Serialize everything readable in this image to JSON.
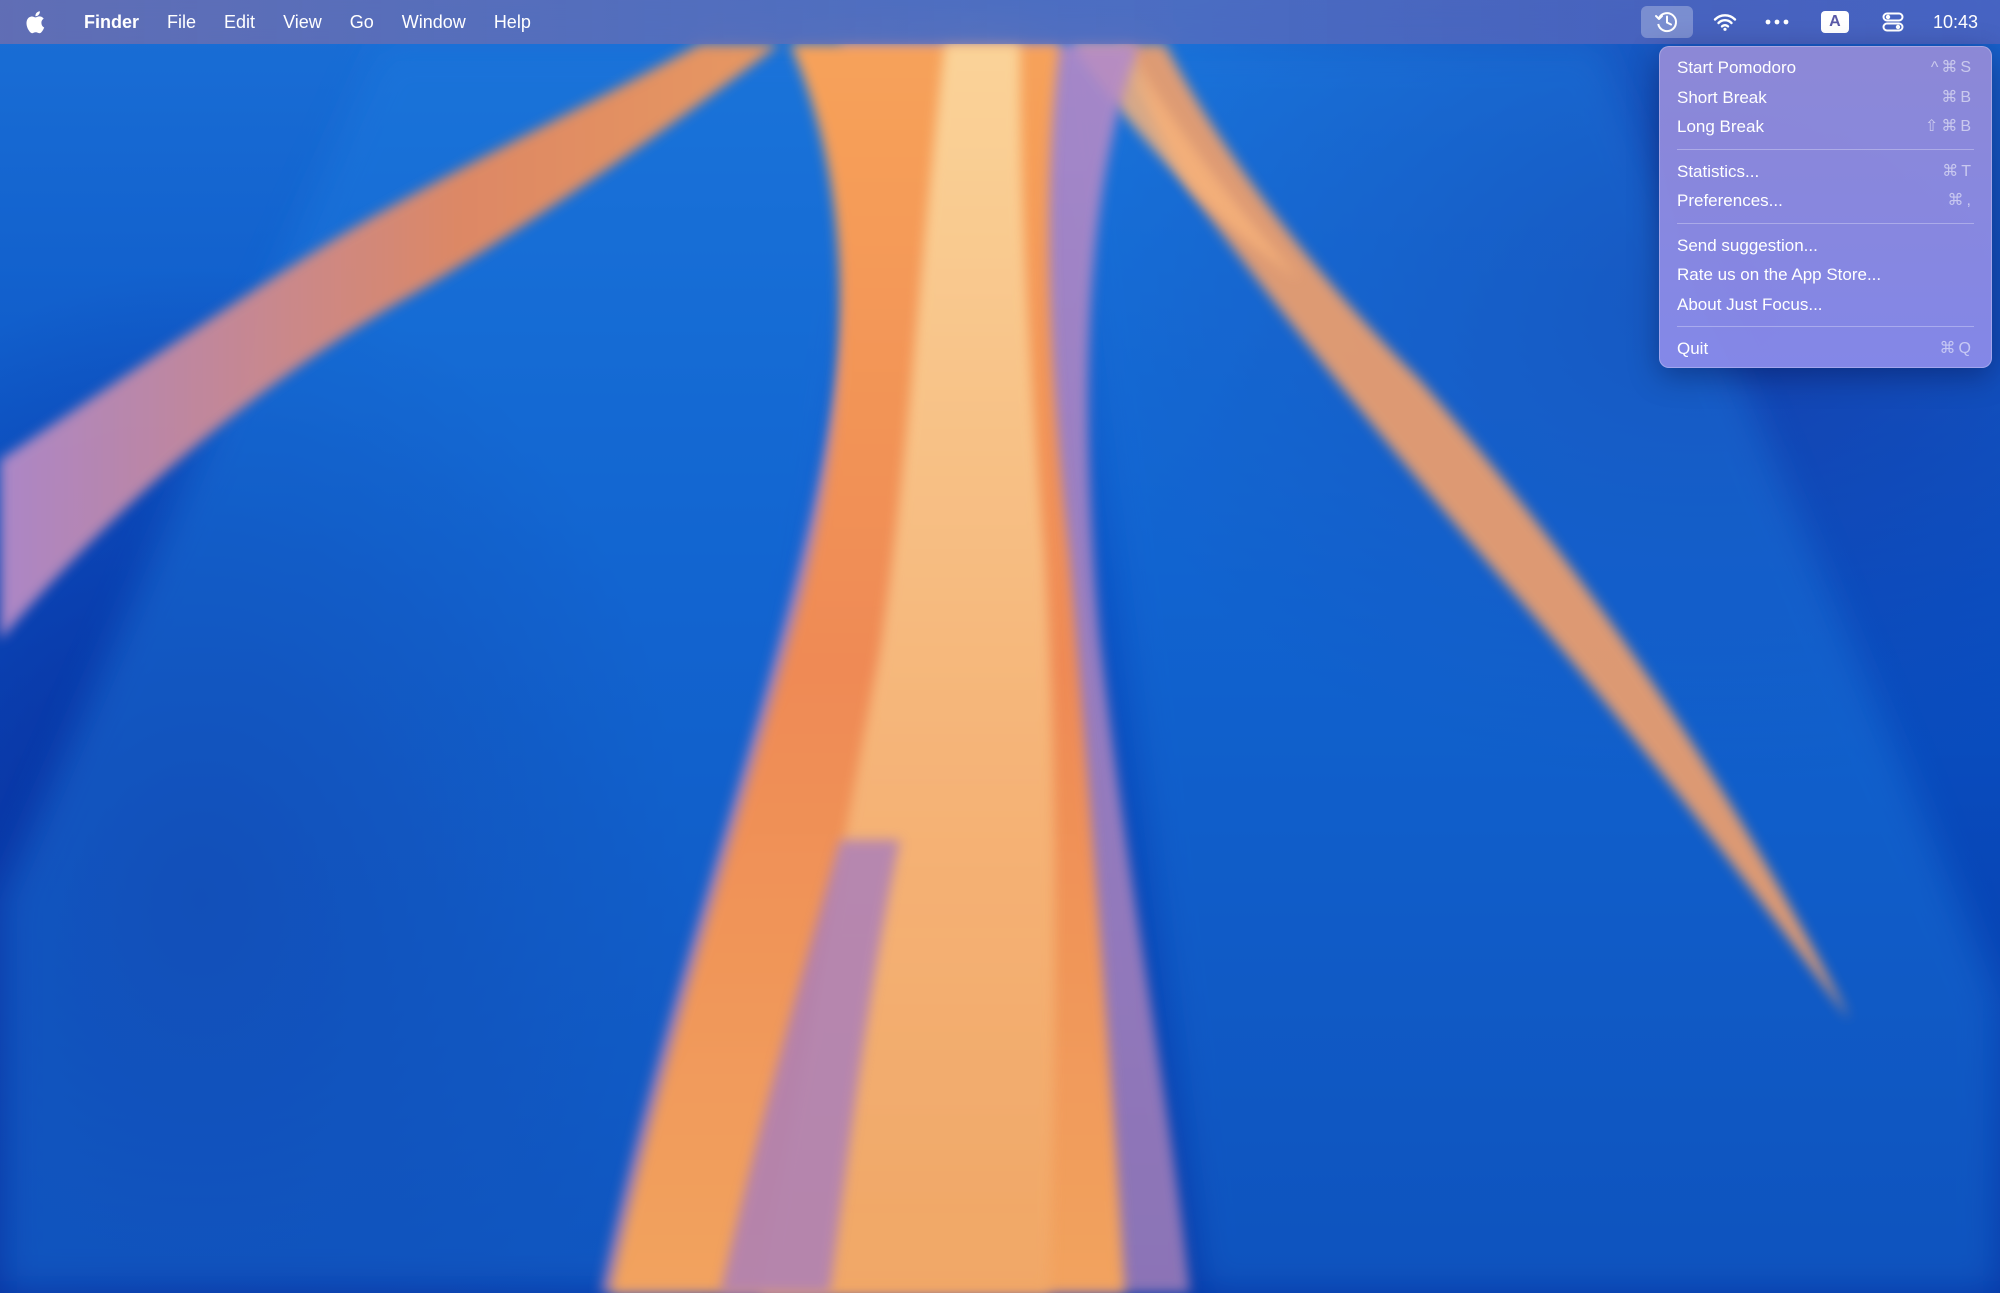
{
  "menubar": {
    "app_name": "Finder",
    "menus": [
      "File",
      "Edit",
      "View",
      "Go",
      "Window",
      "Help"
    ],
    "keyboard_indicator": "A",
    "clock": "10:43"
  },
  "dropdown": {
    "group1": [
      {
        "label": "Start Pomodoro",
        "shortcut": "^⌘S"
      },
      {
        "label": "Short Break",
        "shortcut": "⌘B"
      },
      {
        "label": "Long Break",
        "shortcut": "⇧⌘B"
      }
    ],
    "group2": [
      {
        "label": "Statistics...",
        "shortcut": "⌘T"
      },
      {
        "label": "Preferences...",
        "shortcut": "⌘,"
      }
    ],
    "group3": [
      {
        "label": "Send suggestion...",
        "shortcut": ""
      },
      {
        "label": "Rate us on the App Store...",
        "shortcut": ""
      },
      {
        "label": "About Just Focus...",
        "shortcut": ""
      }
    ],
    "group4": [
      {
        "label": "Quit",
        "shortcut": "⌘Q"
      }
    ]
  }
}
